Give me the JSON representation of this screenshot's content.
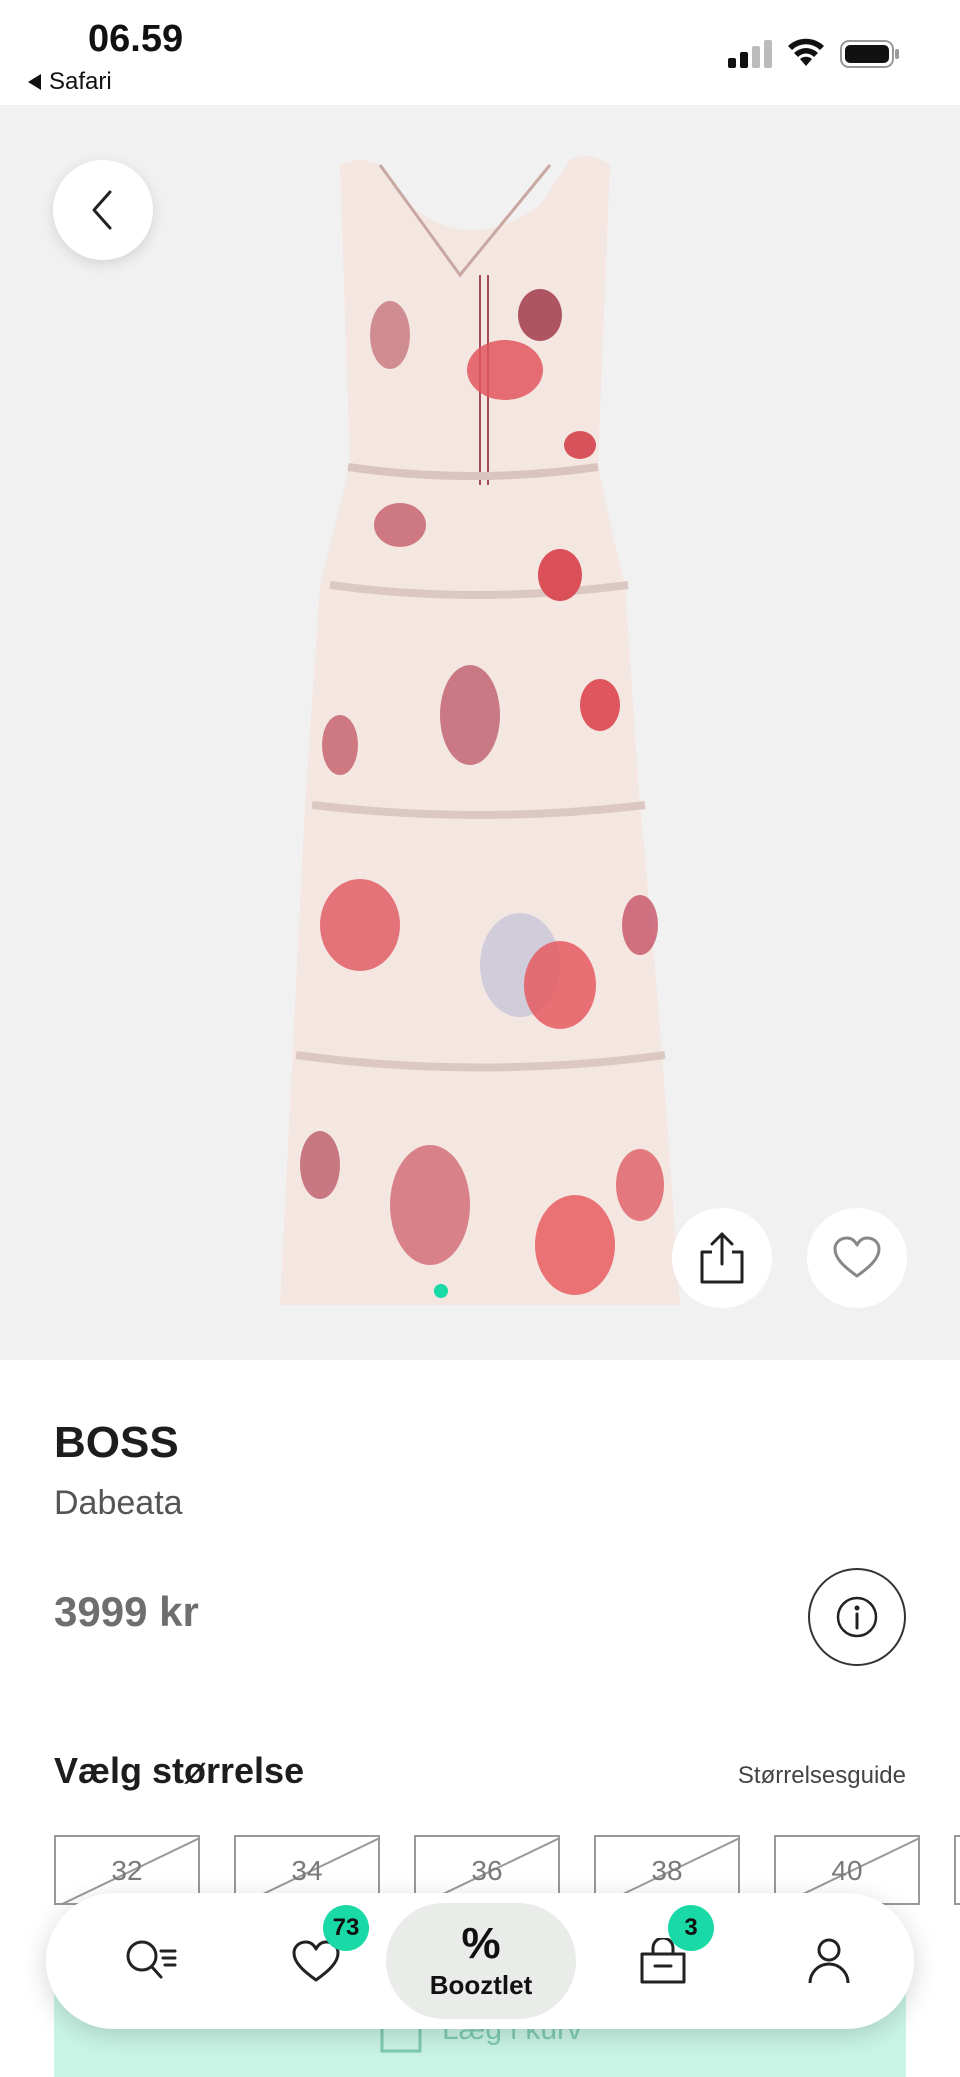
{
  "status_bar": {
    "time": "06.59",
    "back_app": "Safari"
  },
  "product": {
    "brand": "BOSS",
    "name": "Dabeata",
    "price": "3999 kr"
  },
  "size_section": {
    "heading": "Vælg størrelse",
    "guide_link": "Størrelsesguide",
    "sizes": [
      {
        "label": "32",
        "available": false
      },
      {
        "label": "34",
        "available": false
      },
      {
        "label": "36",
        "available": false
      },
      {
        "label": "38",
        "available": false
      },
      {
        "label": "40",
        "available": false
      }
    ]
  },
  "cart": {
    "button_label": "Læg i kurv"
  },
  "nav": {
    "search_icon": "search-filter-icon",
    "wishlist_count": "73",
    "center_symbol": "%",
    "center_label": "Booztlet",
    "basket_count": "3"
  },
  "colors": {
    "accent": "#19d9a6",
    "image_bg": "#f2f1f1",
    "cart_bg": "#c9f4e6"
  }
}
